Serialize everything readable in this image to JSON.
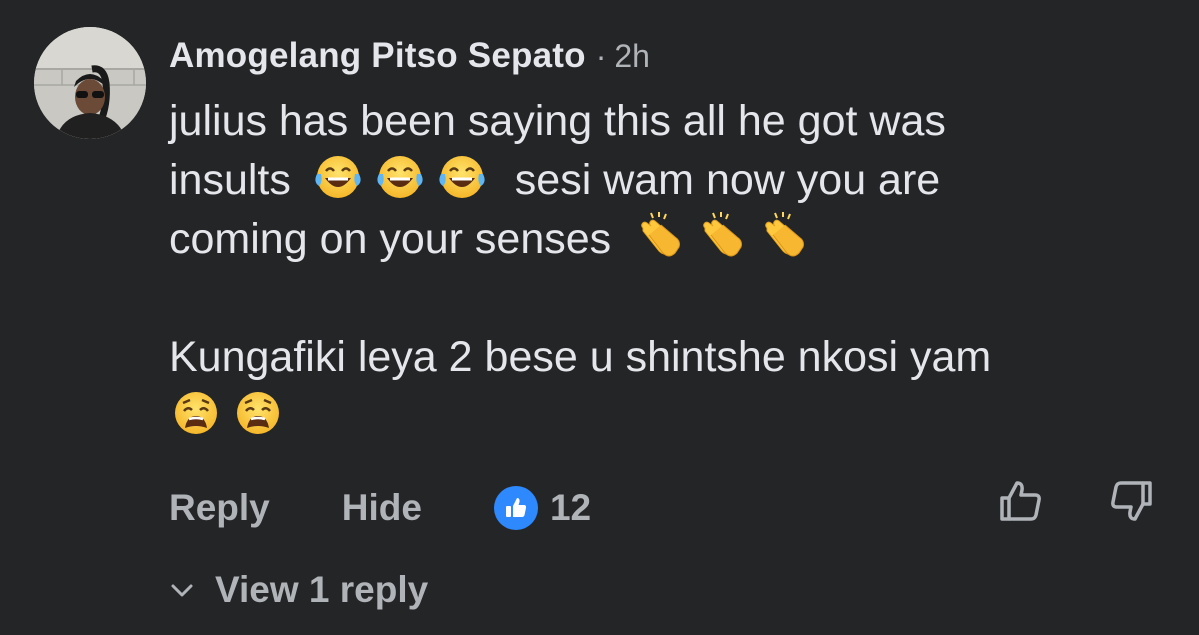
{
  "comment": {
    "author": "Amogelang Pitso Sepato",
    "separator": "·",
    "timestamp": "2h",
    "paragraphs": {
      "p1_line1": "julius has been saying this all he got was",
      "p1_line2_a": "insults",
      "p1_line2_b": "sesi wam now you are",
      "p1_line3": "coming on your senses",
      "p2_line1": "Kungafiki leya 2 bese u shintshe nkosi yam"
    },
    "emojis": {
      "laughing": "face-with-tears-of-joy-icon",
      "clapping": "clapping-hands-icon",
      "weary": "weary-face-icon"
    }
  },
  "actions": {
    "reply_label": "Reply",
    "hide_label": "Hide",
    "reaction_icon": "like-badge-icon",
    "reaction_count": "12",
    "upvote_icon": "thumb-up-outline-icon",
    "downvote_icon": "thumb-down-outline-icon"
  },
  "replies": {
    "view_label": "View 1 reply",
    "icon": "chevron-down-icon"
  },
  "colors": {
    "background": "#242526",
    "primary_text": "#e4e6eb",
    "secondary_text": "#b0b3b8",
    "like_blue": "#2e89ff"
  }
}
